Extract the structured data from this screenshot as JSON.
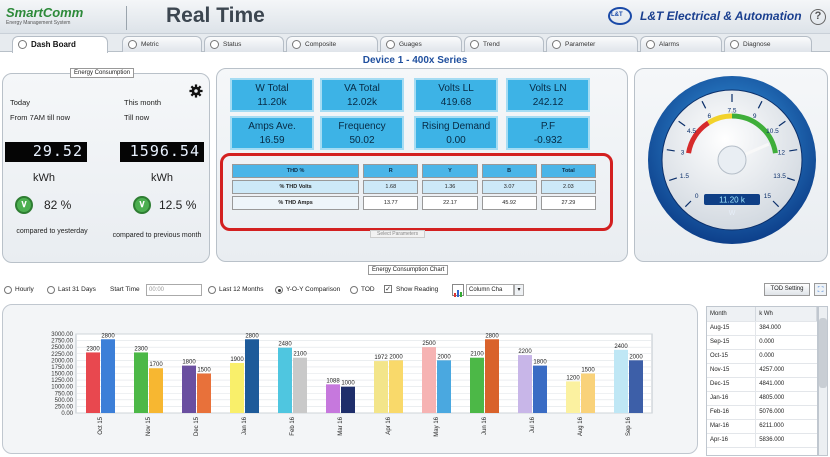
{
  "header": {
    "logo_main": "SmartComm",
    "logo_sub": "Energy Management System",
    "title": "Real Time",
    "brand_logo_text": "L&T",
    "brand_name": "L&T Electrical & Automation",
    "help": "?"
  },
  "tabs": [
    {
      "label": "Dash Board",
      "active": true
    },
    {
      "label": "Metric"
    },
    {
      "label": "Status"
    },
    {
      "label": "Composite"
    },
    {
      "label": "Guages"
    },
    {
      "label": "Trend"
    },
    {
      "label": "Parameter"
    },
    {
      "label": "Alarms"
    },
    {
      "label": "Diagnose"
    }
  ],
  "device_title": "Device 1  -  400x Series",
  "energy": {
    "legend": "Energy Consumption",
    "today_label": "Today",
    "today_sub": "From 7AM till now",
    "month_label": "This month",
    "month_sub": "Till now",
    "today_value": "29.52",
    "month_value": "1596.54",
    "unit": "kWh",
    "today_pct": "82 %",
    "month_pct": "12.5 %",
    "today_compare": "compared to yesterday",
    "month_compare": "compared to previous month",
    "down_glyph": "∨"
  },
  "metrics": [
    {
      "title": "W Total",
      "value": "11.20k"
    },
    {
      "title": "VA Total",
      "value": "12.02k"
    },
    {
      "title": "Volts LL",
      "value": "419.68"
    },
    {
      "title": "Volts LN",
      "value": "242.12"
    },
    {
      "title": "Amps Ave.",
      "value": "16.59"
    },
    {
      "title": "Frequency",
      "value": "50.02"
    },
    {
      "title": "Rising Demand",
      "value": "0.00"
    },
    {
      "title": "P.F",
      "value": "-0.932"
    }
  ],
  "thd": {
    "headers": [
      "THD %",
      "R",
      "Y",
      "B",
      "Total"
    ],
    "rows": [
      [
        "% THD Volts",
        "1.68",
        "1.36",
        "3.07",
        "2.03"
      ],
      [
        "% THD Amps",
        "13.77",
        "22.17",
        "45.92",
        "27.29"
      ]
    ],
    "select_label": "Select Parameters"
  },
  "gauge": {
    "ticks": [
      "0",
      "1.5",
      "3",
      "4.5",
      "6",
      "7.5",
      "9",
      "10.5",
      "12",
      "13.5",
      "15"
    ],
    "value": 11.2,
    "max": 15,
    "readout": "11.20 k",
    "unit": "W"
  },
  "chart_controls": {
    "legend": "Energy Consumption Chart",
    "hourly": "Hourly",
    "last31": "Last 31 Days",
    "start_time": "Start Time",
    "start_time_value": "00:00",
    "last12": "Last 12 Months",
    "yoy": "Y-O-Y Comparison",
    "tod": "TOD",
    "show_reading": "Show Reading",
    "chart_type": "Column Cha",
    "tod_setting": "TOD Setting"
  },
  "chart_data": {
    "type": "bar",
    "categories": [
      "Oct 15",
      "Nov 15",
      "Dec 15",
      "Jan 16",
      "Feb 16",
      "Mar 16",
      "Apr 16",
      "May 16",
      "Jun 16",
      "Jul 16",
      "Aug 16",
      "Sep 16"
    ],
    "series": [
      {
        "values": [
          2300,
          2300,
          1800,
          1900,
          2480,
          1088,
          1972,
          2500,
          2100,
          2200,
          1200,
          2400
        ]
      },
      {
        "values": [
          2800,
          1700,
          1500,
          2800,
          2100,
          1000,
          2000,
          2000,
          2800,
          1800,
          1500,
          2000
        ]
      }
    ],
    "colors": [
      [
        "#e8484f",
        "#3c7fd8"
      ],
      [
        "#4cb847",
        "#f7b731"
      ],
      [
        "#6a4fa0",
        "#e8713a"
      ],
      [
        "#f9ef6a",
        "#1e5b9a"
      ],
      [
        "#4fc6e0",
        "#c9c9c9"
      ],
      [
        "#c678dd",
        "#1f2f6b"
      ],
      [
        "#f3e58a",
        "#f9d96a"
      ],
      [
        "#f6b3b3",
        "#4aa8e0"
      ],
      [
        "#4cb847",
        "#d9622b"
      ],
      [
        "#c8b6e8",
        "#3a6cc4"
      ],
      [
        "#fbf1a0",
        "#f9d27a"
      ],
      [
        "#bfe7f5",
        "#3d5fa8"
      ]
    ],
    "yticks": [
      "0.00",
      "250.00",
      "500.00",
      "750.00",
      "1000.00",
      "1250.00",
      "1500.00",
      "1750.00",
      "2000.00",
      "2250.00",
      "2500.00",
      "2750.00",
      "3000.00"
    ],
    "ylim": [
      0,
      3000
    ]
  },
  "side_table": {
    "headers": [
      "Month",
      "k Wh"
    ],
    "rows": [
      [
        "Aug-15",
        "384.000"
      ],
      [
        "Sep-15",
        "0.000"
      ],
      [
        "Oct-15",
        "0.000"
      ],
      [
        "Nov-15",
        "4257.000"
      ],
      [
        "Dec-15",
        "4841.000"
      ],
      [
        "Jan-16",
        "4805.000"
      ],
      [
        "Feb-16",
        "5076.000"
      ],
      [
        "Mar-16",
        "6211.000"
      ],
      [
        "Apr-16",
        "5836.000"
      ]
    ]
  }
}
